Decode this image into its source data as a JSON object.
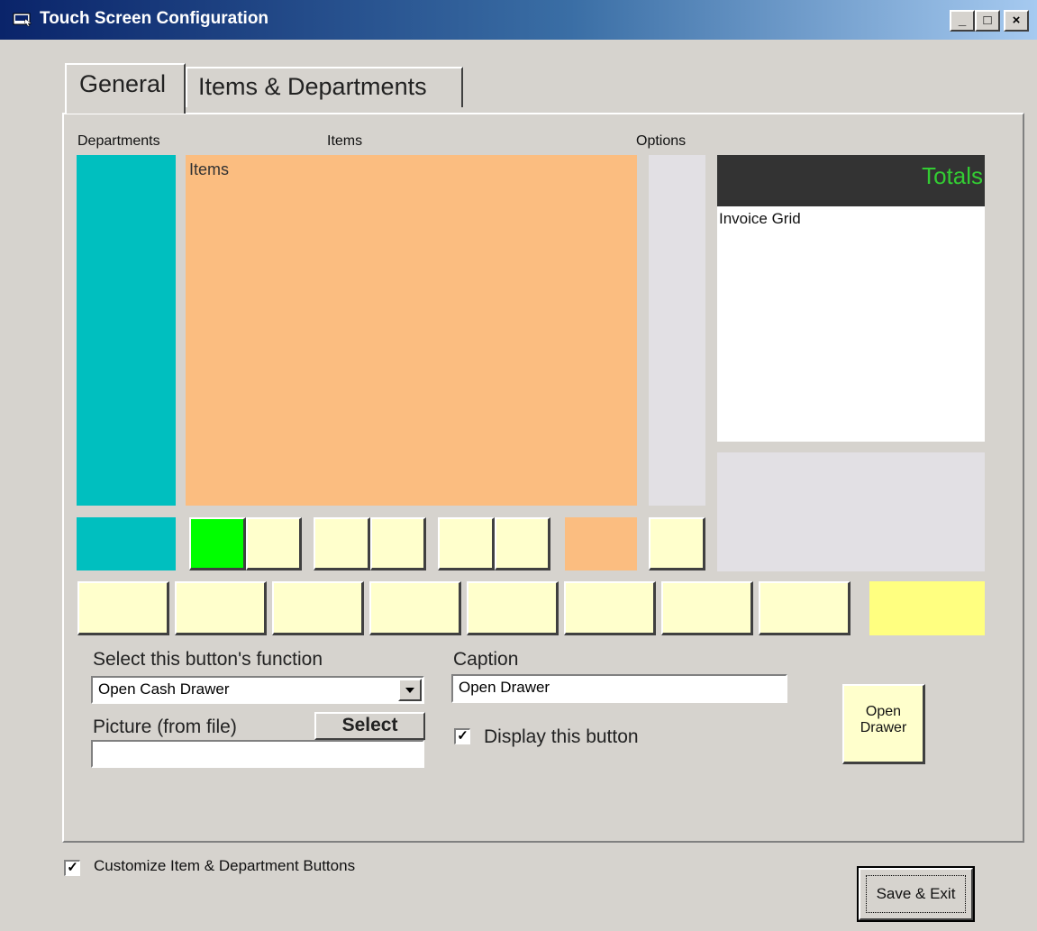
{
  "window": {
    "title": "Touch Screen Configuration"
  },
  "title_buttons": {
    "minimize": "_",
    "maximize": "□",
    "close": "×"
  },
  "tabs": [
    {
      "label": "General"
    },
    {
      "label": "Items & Departments"
    }
  ],
  "layout_preview": {
    "departments_label": "Departments",
    "items_label": "Items",
    "options_label": "Options",
    "items_area_text": "Items",
    "totals_text": "Totals",
    "invoice_grid_text": "Invoice Grid",
    "colors": {
      "departments": "#00bfbf",
      "items": "#fbbd80",
      "options": "#e2e0e4",
      "totals_bg": "#333333",
      "totals_text": "#33cc33",
      "button": "#ffffcc",
      "selected_button": "#00ff00",
      "highlight_button": "#ffff80"
    }
  },
  "function_section": {
    "select_label": "Select this button's function",
    "select_value": "Open Cash Drawer",
    "picture_label": "Picture (from file)",
    "select_button": "Select",
    "picture_value": "",
    "caption_label": "Caption",
    "caption_value": "Open Drawer",
    "display_checkbox": {
      "label": "Display this button",
      "checked": true
    },
    "preview_button_line1": "Open",
    "preview_button_line2": "Drawer"
  },
  "customize_checkbox": {
    "label": "Customize Item & Department Buttons",
    "checked": true
  },
  "save_exit_button": "Save & Exit"
}
